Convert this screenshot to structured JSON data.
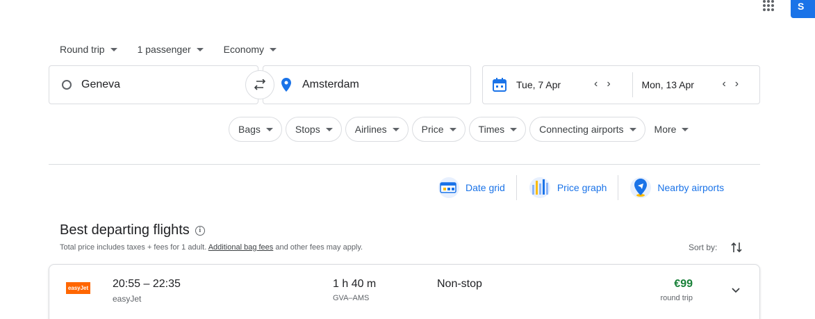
{
  "topbar": {
    "signin_label": "S"
  },
  "trip_options": {
    "trip_type": "Round trip",
    "passengers": "1 passenger",
    "cabin": "Economy"
  },
  "search": {
    "origin": "Geneva",
    "destination": "Amsterdam",
    "depart_date": "Tue, 7 Apr",
    "return_date": "Mon, 13 Apr"
  },
  "filters": [
    "Bags",
    "Stops",
    "Airlines",
    "Price",
    "Times",
    "Connecting airports",
    "More"
  ],
  "tools": {
    "date_grid": "Date grid",
    "price_graph": "Price graph",
    "nearby_airports": "Nearby airports"
  },
  "results": {
    "title": "Best departing flights",
    "subtitle_prefix": "Total price includes taxes + fees for 1 adult.",
    "subtitle_link": "Additional bag fees",
    "subtitle_suffix": "and other fees may apply.",
    "sort_label": "Sort by:",
    "flights": [
      {
        "logo_text": "easyJet",
        "times": "20:55 – 22:35",
        "airline": "easyJet",
        "duration": "1 h 40 m",
        "route": "GVA–AMS",
        "stops": "Non-stop",
        "price": "€99",
        "price_type": "round trip"
      }
    ]
  },
  "colors": {
    "accent": "#1a73e8",
    "price_green": "#188038",
    "easyjet_orange": "#ff6600"
  }
}
